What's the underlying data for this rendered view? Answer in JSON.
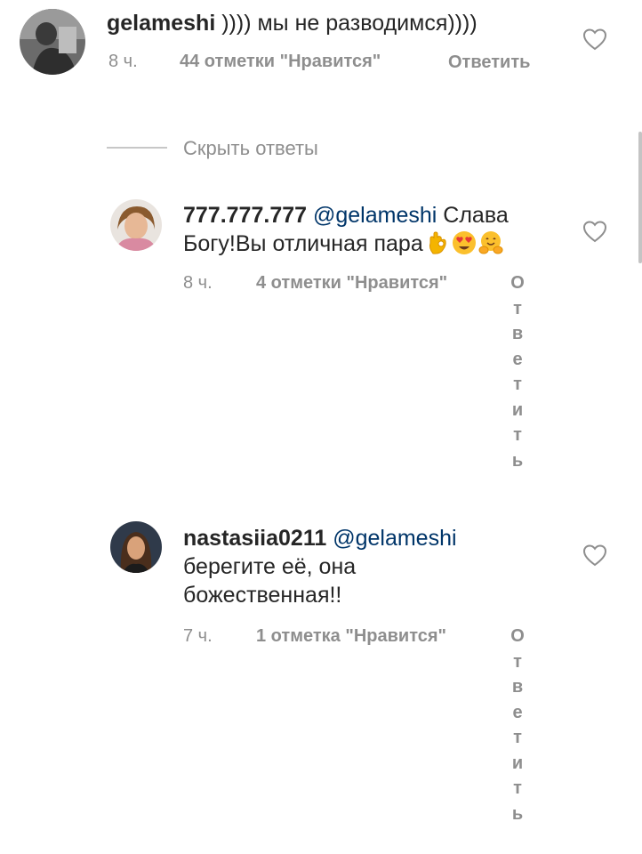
{
  "comments": [
    {
      "username": "gelameshi",
      "mention": "",
      "text": " )))) мы не разводимся))))",
      "time": "8 ч.",
      "likes": "44 отметки \"Нравится\"",
      "reply": "Ответить"
    },
    {
      "username": "777.777.777",
      "mention": "@gelameshi",
      "text": " Слава Богу!Вы отличная пара",
      "emojis": [
        "ok-hand-emoji",
        "heart-eyes-emoji",
        "hugging-face-emoji"
      ],
      "time": "8 ч.",
      "likes": "4 отметки \"Нравится\"",
      "reply": "Ответить"
    },
    {
      "username": "nastasiia0211",
      "mention": "@gelameshi",
      "text": "берегите её, она божественная!!",
      "time": "7 ч.",
      "likes": "1 отметка \"Нравится\"",
      "reply": "Ответить"
    }
  ],
  "replies_toggle": {
    "label": "Скрыть ответы"
  },
  "icons": {
    "like": "heart-outline-icon",
    "accent": "#003569",
    "meta_color": "#8e8e8e"
  }
}
